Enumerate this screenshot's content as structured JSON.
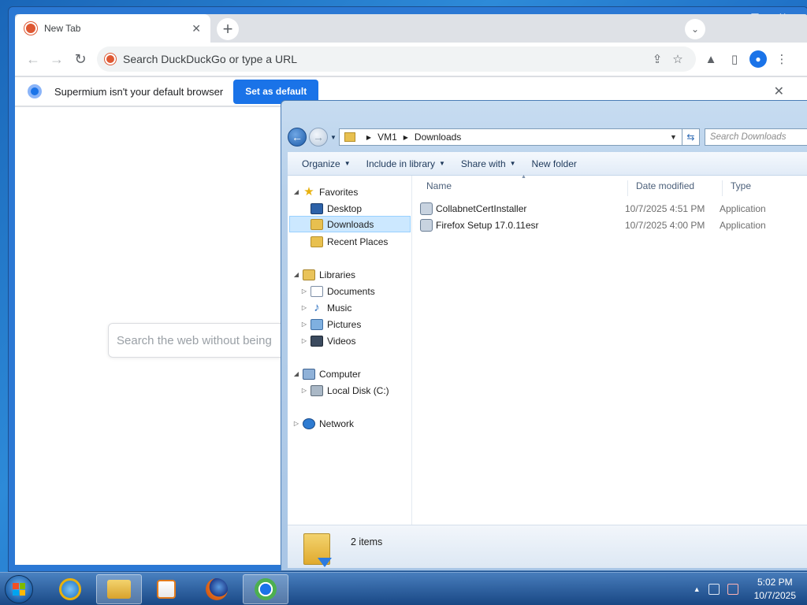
{
  "browser": {
    "tab_title": "New Tab",
    "tab_close": "✕",
    "new_tab": "+",
    "tab_search": "⌄",
    "window_controls": {
      "minimize": "▁",
      "maximize": "□",
      "close": "✕"
    },
    "nav": {
      "back": "←",
      "forward": "→",
      "reload": "↻"
    },
    "omnibox_text": "Search DuckDuckGo or type a URL",
    "omnibox_icons": {
      "share": "⇪",
      "bookmark": "☆"
    },
    "toolbar_icons": {
      "labs": "▲",
      "side_panel": "▯",
      "menu": "⋮",
      "profile": "●"
    },
    "infobar": {
      "message": "Supermium isn't your default browser",
      "button": "Set as default",
      "close": "✕"
    },
    "page_search_placeholder": "Search the web without being"
  },
  "explorer": {
    "back": "←",
    "forward": "→",
    "breadcrumb": [
      "VM1",
      "Downloads"
    ],
    "search_placeholder": "Search Downloads",
    "refresh": "⇆",
    "commands": [
      {
        "label": "Organize",
        "dropdown": true
      },
      {
        "label": "Include in library",
        "dropdown": true
      },
      {
        "label": "Share with",
        "dropdown": true
      },
      {
        "label": "New folder",
        "dropdown": false
      }
    ],
    "nav_pane": {
      "favorites": {
        "label": "Favorites",
        "items": [
          "Desktop",
          "Downloads",
          "Recent Places"
        ]
      },
      "libraries": {
        "label": "Libraries",
        "items": [
          "Documents",
          "Music",
          "Pictures",
          "Videos"
        ]
      },
      "computer": {
        "label": "Computer",
        "items": [
          "Local Disk (C:)"
        ]
      },
      "network": {
        "label": "Network"
      }
    },
    "columns": [
      "Name",
      "Date modified",
      "Type"
    ],
    "files": [
      {
        "name": "CollabnetCertInstaller",
        "date": "10/7/2025 4:51 PM",
        "type": "Application"
      },
      {
        "name": "Firefox Setup 17.0.11esr",
        "date": "10/7/2025 4:00 PM",
        "type": "Application"
      }
    ],
    "status": "2 items"
  },
  "taskbar": {
    "clock_time": "5:02 PM",
    "clock_date": "10/7/2025",
    "tray_expand": "▲"
  }
}
